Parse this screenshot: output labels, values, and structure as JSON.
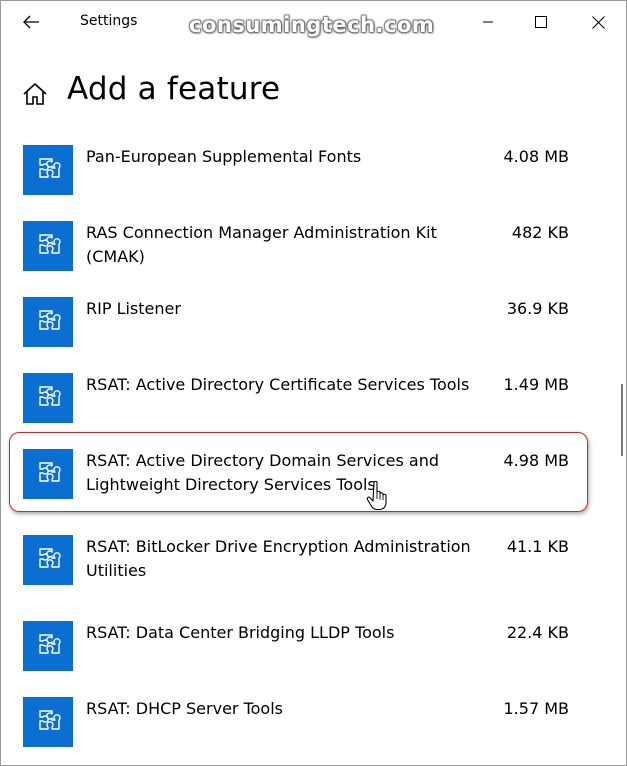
{
  "window": {
    "app_title": "Settings",
    "watermark": "consumingtech.com"
  },
  "header": {
    "title": "Add a feature"
  },
  "features": [
    {
      "name": "Pan-European Supplemental Fonts",
      "size": "4.08 MB"
    },
    {
      "name": "RAS Connection Manager Administration Kit (CMAK)",
      "size": "482 KB"
    },
    {
      "name": "RIP Listener",
      "size": "36.9 KB"
    },
    {
      "name": "RSAT: Active Directory Certificate Services Tools",
      "size": "1.49 MB"
    },
    {
      "name": "RSAT: Active Directory Domain Services and Lightweight Directory Services Tools",
      "size": "4.98 MB"
    },
    {
      "name": "RSAT: BitLocker Drive Encryption Administration Utilities",
      "size": "41.1 KB"
    },
    {
      "name": "RSAT: Data Center Bridging LLDP Tools",
      "size": "22.4 KB"
    },
    {
      "name": "RSAT: DHCP Server Tools",
      "size": "1.57 MB"
    }
  ],
  "colors": {
    "tile": "#0a6fd1",
    "highlight": "#d9232b"
  },
  "icons": {
    "back": "back-arrow-icon",
    "home": "home-icon",
    "feature": "puzzle-piece-icon",
    "cursor": "hand-pointer-icon"
  }
}
